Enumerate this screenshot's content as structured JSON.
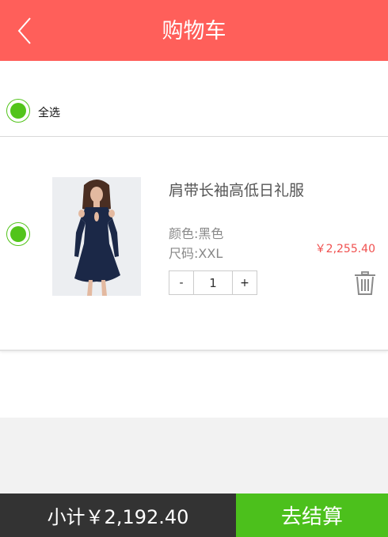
{
  "header": {
    "title": "购物车",
    "back_icon": "chevron-left-icon"
  },
  "select_all": {
    "label": "全选",
    "checked": true
  },
  "cart_items": [
    {
      "name": "肩带长袖高低日礼服",
      "color": "颜色:黑色",
      "size": "尺码:XXL",
      "price": "￥2,255.40",
      "quantity": "1",
      "minus_label": "-",
      "plus_label": "+",
      "checked": true
    }
  ],
  "footer": {
    "subtotal": "小计￥2,192.40",
    "checkout_label": "去结算"
  },
  "colors": {
    "header": "#ff5f5a",
    "accent_green": "#4cc01c",
    "price": "#f0504f",
    "footer_dark": "#333333"
  }
}
